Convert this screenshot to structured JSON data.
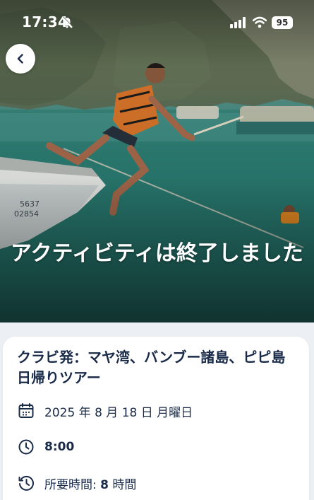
{
  "status_bar": {
    "time": "17:34",
    "battery": "95",
    "icons": [
      "bell-off-icon",
      "signal-icon",
      "wifi-icon",
      "battery-icon"
    ]
  },
  "header": {
    "back_icon": "chevron-left-icon"
  },
  "hero": {
    "status_message": "アクティビティは終了しました",
    "boat_number_1": "5637",
    "boat_number_2": "02854"
  },
  "activity": {
    "title": "クラビ発：マヤ湾、バンブー諸島、ピピ島日帰りツアー",
    "date": "2025 年 8 月 18 日 月曜日",
    "time": "8:00",
    "duration_label": "所要時間:",
    "duration_value": "8",
    "duration_unit": "時間"
  },
  "colors": {
    "text_primary": "#1a2b49",
    "background": "#eceff3",
    "card": "#ffffff"
  }
}
